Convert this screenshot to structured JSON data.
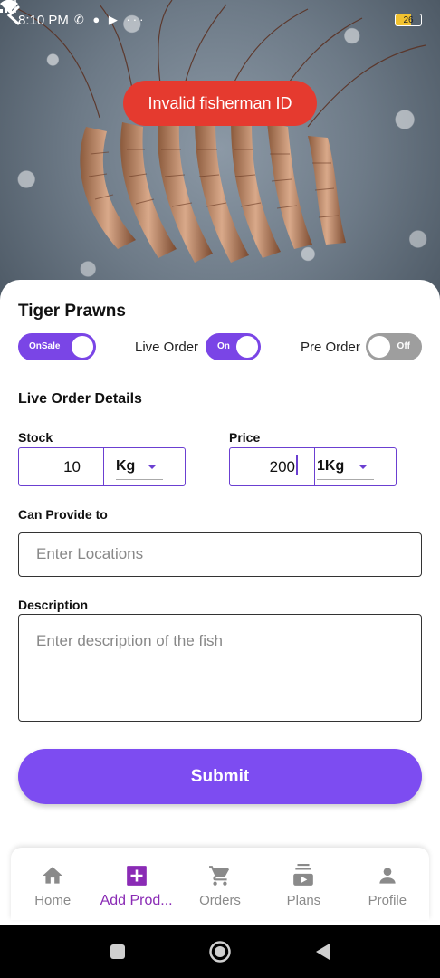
{
  "status_bar": {
    "time": "8:10 PM",
    "battery": "26"
  },
  "toast": {
    "message": "Invalid fisherman ID"
  },
  "product": {
    "name": "Tiger Prawns"
  },
  "toggles": {
    "on_sale": {
      "label": "OnSale",
      "state": "on"
    },
    "live_order": {
      "caption": "Live Order",
      "label": "On",
      "state": "on"
    },
    "pre_order": {
      "caption": "Pre Order",
      "label": "Off",
      "state": "off"
    }
  },
  "live_order_details": {
    "title": "Live Order Details",
    "stock": {
      "label": "Stock",
      "value": "10",
      "unit": "Kg"
    },
    "price": {
      "label": "Price",
      "value": "200",
      "unit": "1Kg"
    }
  },
  "can_provide_to": {
    "label": "Can Provide to",
    "placeholder": "Enter Locations"
  },
  "description": {
    "label": "Description",
    "placeholder": "Enter description of the fish"
  },
  "submit_label": "Submit",
  "bottom_nav": {
    "items": [
      {
        "label": "Home",
        "icon": "home-icon",
        "active": false
      },
      {
        "label": "Add Prod...",
        "icon": "add-box-icon",
        "active": true
      },
      {
        "label": "Orders",
        "icon": "cart-icon",
        "active": false
      },
      {
        "label": "Plans",
        "icon": "subscriptions-icon",
        "active": false
      },
      {
        "label": "Profile",
        "icon": "person-icon",
        "active": false
      }
    ]
  },
  "colors": {
    "accent": "#7d4cf1",
    "toast": "#e53a2f",
    "active_nav": "#8a2bb5"
  }
}
